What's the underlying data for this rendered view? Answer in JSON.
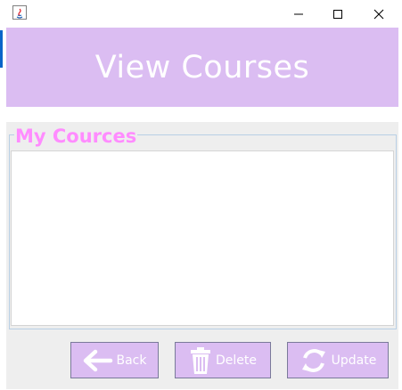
{
  "window": {
    "app_icon": "java-icon",
    "controls": [
      "minimize-icon",
      "maximize-icon",
      "close-icon"
    ]
  },
  "header": {
    "title": "View Courses"
  },
  "courses_panel": {
    "legend": "My Cources",
    "items": []
  },
  "buttons": {
    "back": {
      "label": "Back",
      "icon": "arrow-left-icon"
    },
    "delete": {
      "label": "Delete",
      "icon": "trash-icon"
    },
    "update": {
      "label": "Update",
      "icon": "refresh-icon"
    }
  },
  "colors": {
    "header_bg": "#dbbdf2",
    "legend_text": "#ff8cff",
    "button_bg": "#dbbdf2"
  }
}
